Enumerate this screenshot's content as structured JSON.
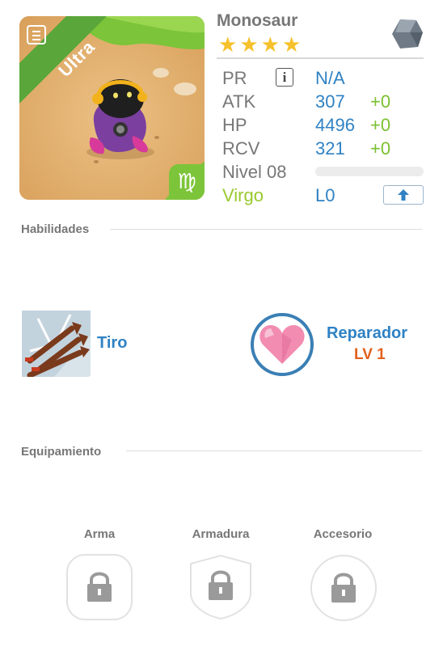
{
  "portrait": {
    "rarity": "Ultra",
    "zodiac_symbol": "♍"
  },
  "monster": {
    "name": "Monosaur",
    "stars": [
      "★",
      "★",
      "★",
      "★"
    ]
  },
  "stats": {
    "pr": {
      "label": "PR",
      "value": "N/A"
    },
    "atk": {
      "label": "ATK",
      "value": "307",
      "bonus": "+0"
    },
    "hp": {
      "label": "HP",
      "value": "4496",
      "bonus": "+0"
    },
    "rcv": {
      "label": "RCV",
      "value": "321",
      "bonus": "+0"
    },
    "level_label": "Nivel 08",
    "zodiac": "Virgo",
    "limit": "L0"
  },
  "info_glyph": "i",
  "sections": {
    "skills": "Habilidades",
    "equipment": "Equipamiento"
  },
  "skills": [
    {
      "name": "Tiro"
    },
    {
      "name": "Reparador",
      "level": "LV 1"
    }
  ],
  "equipment": [
    {
      "label": "Arma"
    },
    {
      "label": "Armadura"
    },
    {
      "label": "Accesorio"
    }
  ],
  "colors": {
    "accent_blue": "#2f82c4",
    "bonus_green": "#7bbf30",
    "star": "#f6c12c",
    "level_orange": "#e3601c"
  }
}
